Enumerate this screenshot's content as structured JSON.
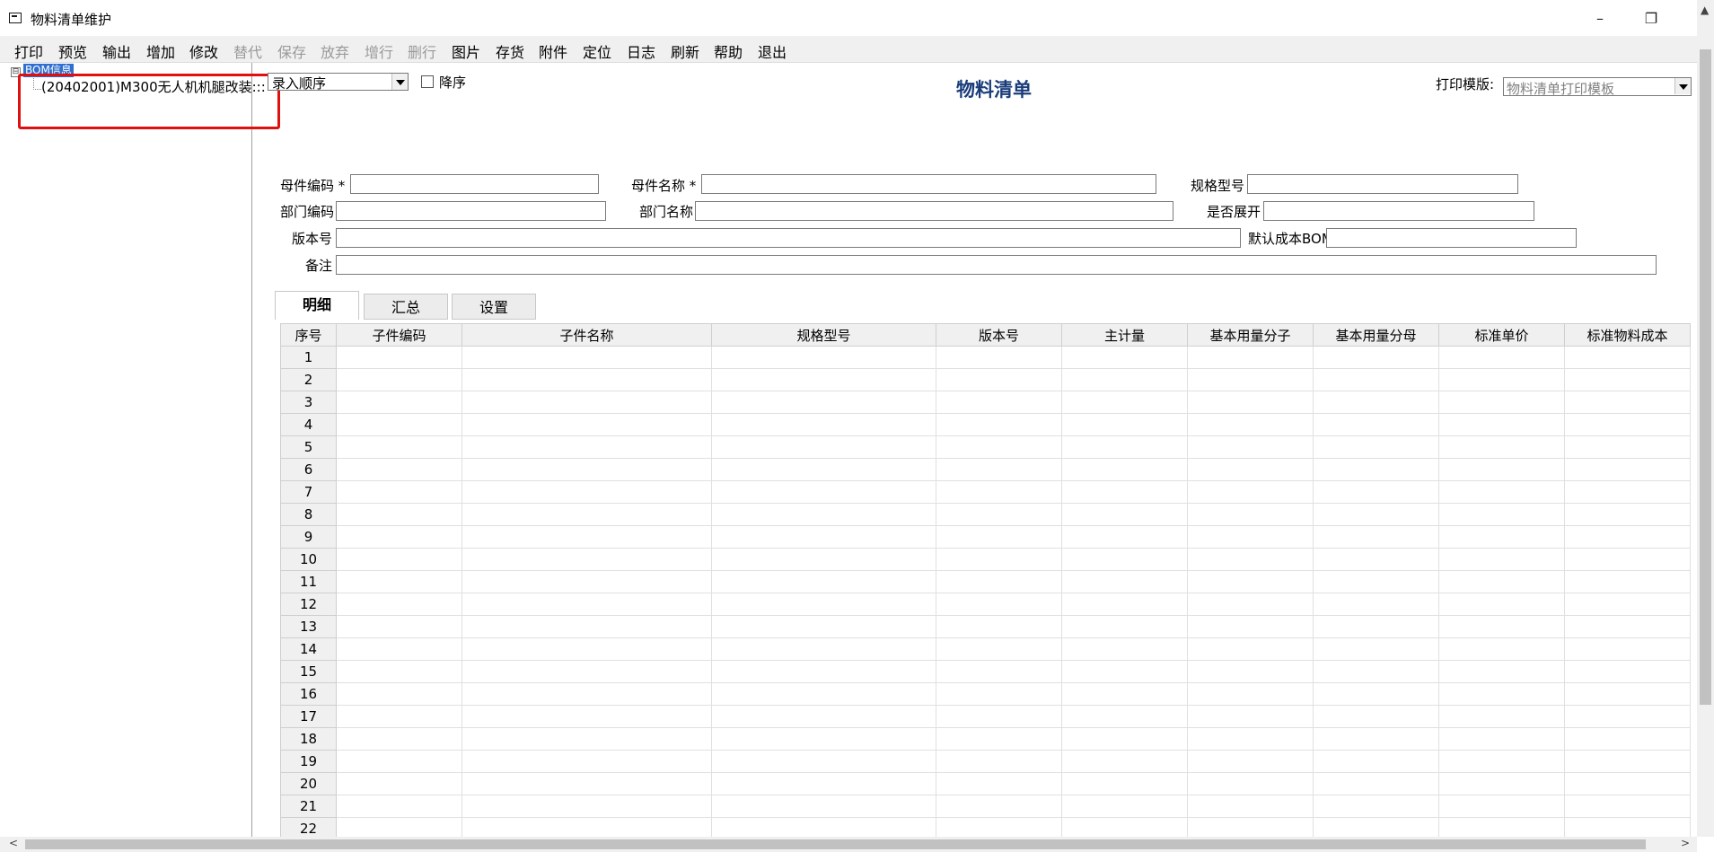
{
  "window": {
    "title": "物料清单维护",
    "minimize": "–",
    "restore": "❐"
  },
  "menu": [
    "打印",
    "预览",
    "输出",
    "增加",
    "修改",
    "替代",
    "保存",
    "放弃",
    "增行",
    "删行",
    "图片",
    "存货",
    "附件",
    "定位",
    "日志",
    "刷新",
    "帮助",
    "退出"
  ],
  "menu_disabled": [
    "替代",
    "保存",
    "放弃",
    "增行",
    "删行"
  ],
  "tree": {
    "expander": "⊟",
    "root": "BOM信息",
    "child": "(20402001)M300无人机机腿改装:::"
  },
  "sort": {
    "value": "录入顺序",
    "descending_label": "降序"
  },
  "doc_title": "物料清单",
  "print_template": {
    "label": "打印模版:",
    "value": "物料清单打印模板"
  },
  "form": {
    "parent_code": "母件编码 *",
    "parent_name": "母件名称 *",
    "spec": "规格型号",
    "dept_code": "部门编码",
    "dept_name": "部门名称",
    "expand": "是否展开",
    "version": "版本号",
    "default_bom": "默认成本BOM",
    "remark": "备注"
  },
  "tabs": [
    "明细",
    "汇总",
    "设置"
  ],
  "grid": {
    "columns": [
      "序号",
      "子件编码",
      "子件名称",
      "规格型号",
      "版本号",
      "主计量",
      "基本用量分子",
      "基本用量分母",
      "标准单价",
      "标准物料成本"
    ],
    "rows": [
      "1",
      "2",
      "3",
      "4",
      "5",
      "6",
      "7",
      "8",
      "9",
      "10",
      "11",
      "12",
      "13",
      "14",
      "15",
      "16",
      "17",
      "18",
      "19",
      "20",
      "21",
      "22"
    ]
  }
}
